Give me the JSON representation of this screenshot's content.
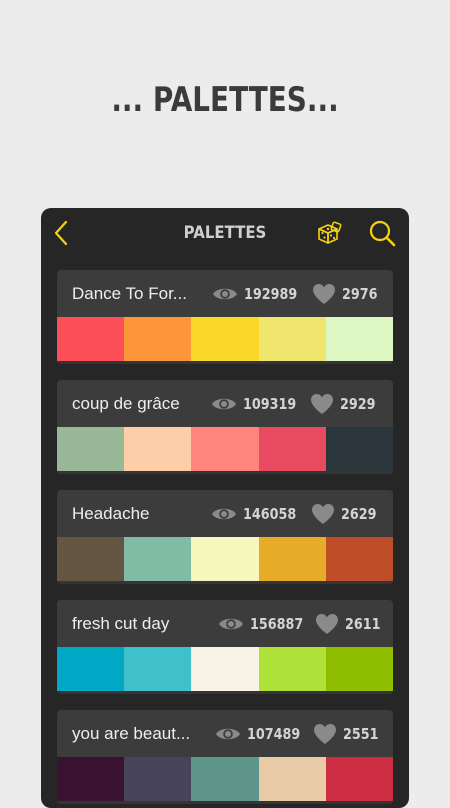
{
  "headline": "... PALETTES...",
  "topbar": {
    "title": "PALETTES",
    "back_icon": "chevron-left-icon",
    "dice_icon": "dice-icon",
    "search_icon": "search-icon",
    "accent": "#f5d312"
  },
  "palettes": [
    {
      "name": "Dance To For...",
      "views": "192989",
      "likes": "2976",
      "colors": [
        "#fd4f57",
        "#fd963a",
        "#fcd72b",
        "#f0e56d",
        "#def6c3"
      ]
    },
    {
      "name": "coup de grâce",
      "views": "109319",
      "likes": "2929",
      "colors": [
        "#99b898",
        "#fecea8",
        "#ff847c",
        "#e84a5f",
        "#2a363b"
      ]
    },
    {
      "name": "Headache",
      "views": "146058",
      "likes": "2629",
      "colors": [
        "#655643",
        "#80bca3",
        "#f6f7bd",
        "#e6ac27",
        "#bf4d28"
      ]
    },
    {
      "name": "fresh cut day",
      "views": "156887",
      "likes": "2611",
      "colors": [
        "#00a8c6",
        "#40c0cb",
        "#f9f2e7",
        "#aee239",
        "#8fbe00"
      ]
    },
    {
      "name": "you are beaut...",
      "views": "107489",
      "likes": "2551",
      "colors": [
        "#3a1330",
        "#474459",
        "#5f968c",
        "#e8cba6",
        "#ce2e44"
      ]
    }
  ]
}
